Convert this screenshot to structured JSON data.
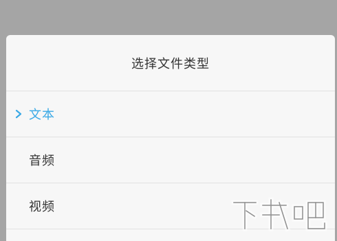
{
  "dialog": {
    "title": "选择文件类型"
  },
  "options": [
    {
      "label": "文本",
      "selected": true
    },
    {
      "label": "音频",
      "selected": false
    },
    {
      "label": "视频",
      "selected": false
    }
  ],
  "colors": {
    "accent": "#3aa9e6",
    "text": "#333333",
    "overlay": "#a5a5a5",
    "sheet": "#f7f7f7",
    "divider": "#e2e2e2"
  },
  "icons": {
    "selected_marker": "chevron-right-icon",
    "watermark": "watermark-logo"
  },
  "watermark": {
    "text": "下载吧"
  }
}
